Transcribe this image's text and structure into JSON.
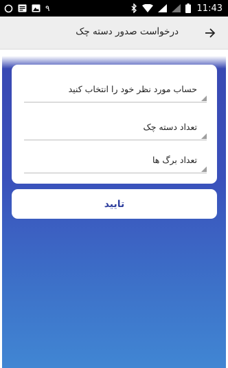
{
  "status_bar": {
    "time": "11:43",
    "notification_count": "۹",
    "icons_left": [
      "sync-icon",
      "message-icon",
      "image-icon"
    ],
    "icons_right": [
      "bluetooth-icon",
      "wifi-icon",
      "signal-icon",
      "signal-icon",
      "battery-icon"
    ]
  },
  "app_bar": {
    "title": "درخواست صدور دسته چک",
    "back_icon": "arrow-forward-icon"
  },
  "form": {
    "account_label": "حساب مورد نظر خود را انتخاب کنید",
    "book_count_label": "تعداد دسته چک",
    "page_count_label": "تعداد برگ ها"
  },
  "actions": {
    "confirm_label": "تایید"
  },
  "colors": {
    "status_bar": "#000000",
    "app_bar": "#eeeeee",
    "gradient_top": "#3949b3",
    "gradient_bottom": "#4186d3",
    "accent_text": "#2f3f9e"
  }
}
